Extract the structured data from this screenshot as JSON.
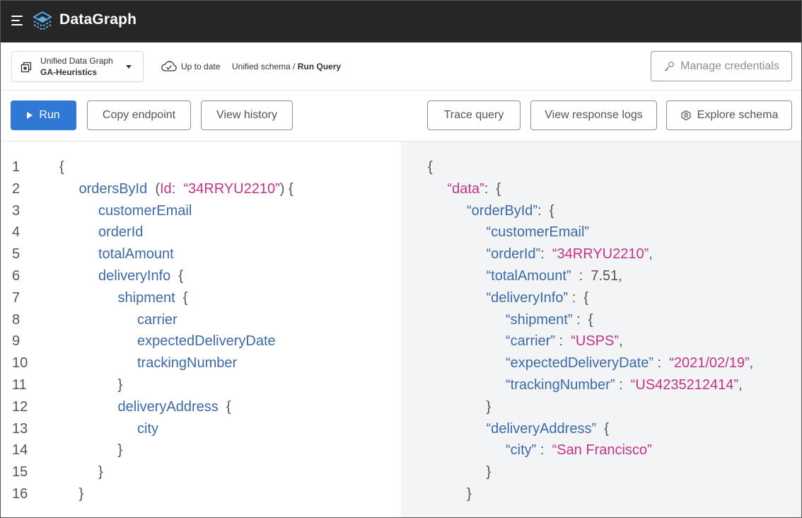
{
  "app": {
    "brand": "DataGraph",
    "colors": {
      "appbar": "#262626",
      "primary": "#2f78d4",
      "field": "#3c6aa8",
      "string": "#c2338a"
    },
    "icons": {
      "menu": "hamburger-menu-icon",
      "logo": "datagraph-logo-icon"
    }
  },
  "subheader": {
    "graph_name": "Unified Data Graph",
    "graph_variant": "GA-Heuristics",
    "status": "Up to date",
    "breadcrumb": {
      "parent": "Unified schema",
      "separator": " / ",
      "current": "Run Query"
    },
    "manage_credentials": "Manage credentials"
  },
  "toolbar": {
    "run": "Run",
    "copy_endpoint": "Copy endpoint",
    "view_history": "View history",
    "trace_query": "Trace query",
    "view_response_logs": "View response logs",
    "explore_schema": "Explore schema"
  },
  "query": {
    "line_numbers": [
      "1",
      "2",
      "3",
      "4",
      "5",
      "6",
      "7",
      "8",
      "9",
      "10",
      "11",
      "12",
      "13",
      "14",
      "15",
      "16"
    ],
    "lines": [
      {
        "indent": 0,
        "parts": [
          {
            "t": "{",
            "c": "p"
          }
        ]
      },
      {
        "indent": 1,
        "parts": [
          {
            "t": "ordersById",
            "c": "k"
          },
          {
            "t": "  (",
            "c": "p"
          },
          {
            "t": "Id",
            "c": "s"
          },
          {
            "t": ":  ",
            "c": "p"
          },
          {
            "t": "“34RRYU2210”",
            "c": "s"
          },
          {
            "t": ") {",
            "c": "p"
          }
        ]
      },
      {
        "indent": 2,
        "parts": [
          {
            "t": "customerEmail",
            "c": "k"
          }
        ]
      },
      {
        "indent": 2,
        "parts": [
          {
            "t": "orderId",
            "c": "k"
          }
        ]
      },
      {
        "indent": 2,
        "parts": [
          {
            "t": "totalAmount",
            "c": "k"
          }
        ]
      },
      {
        "indent": 2,
        "parts": [
          {
            "t": "deliveryInfo",
            "c": "k"
          },
          {
            "t": "  {",
            "c": "p"
          }
        ]
      },
      {
        "indent": 3,
        "parts": [
          {
            "t": "shipment",
            "c": "k"
          },
          {
            "t": "  {",
            "c": "p"
          }
        ]
      },
      {
        "indent": 4,
        "parts": [
          {
            "t": "carrier",
            "c": "k"
          }
        ]
      },
      {
        "indent": 4,
        "parts": [
          {
            "t": "expectedDeliveryDate",
            "c": "k"
          }
        ]
      },
      {
        "indent": 4,
        "parts": [
          {
            "t": "trackingNumber",
            "c": "k"
          }
        ]
      },
      {
        "indent": 3,
        "parts": [
          {
            "t": "}",
            "c": "p"
          }
        ]
      },
      {
        "indent": 3,
        "parts": [
          {
            "t": "deliveryAddress",
            "c": "k"
          },
          {
            "t": "  {",
            "c": "p"
          }
        ]
      },
      {
        "indent": 4,
        "parts": [
          {
            "t": "city",
            "c": "k"
          }
        ]
      },
      {
        "indent": 3,
        "parts": [
          {
            "t": "}",
            "c": "p"
          }
        ]
      },
      {
        "indent": 2,
        "parts": [
          {
            "t": "}",
            "c": "p"
          }
        ]
      },
      {
        "indent": 1,
        "parts": [
          {
            "t": "}",
            "c": "p"
          }
        ]
      }
    ]
  },
  "result": {
    "lines": [
      {
        "indent": 0,
        "parts": [
          {
            "t": "{",
            "c": "p"
          }
        ]
      },
      {
        "indent": 1,
        "parts": [
          {
            "t": "“data”",
            "c": "s"
          },
          {
            "t": ":  {",
            "c": "p"
          }
        ]
      },
      {
        "indent": 2,
        "parts": [
          {
            "t": "“orderById”",
            "c": "k"
          },
          {
            "t": ":  {",
            "c": "p"
          }
        ]
      },
      {
        "indent": 3,
        "parts": [
          {
            "t": "“customerEmail”",
            "c": "k"
          }
        ]
      },
      {
        "indent": 3,
        "parts": [
          {
            "t": "“orderId”",
            "c": "k"
          },
          {
            "t": ":  ",
            "c": "p"
          },
          {
            "t": "“34RRYU2210”",
            "c": "s"
          },
          {
            "t": ",",
            "c": "p"
          }
        ]
      },
      {
        "indent": 3,
        "parts": [
          {
            "t": "“totalAmount”",
            "c": "k"
          },
          {
            "t": "  :  7.51,",
            "c": "p"
          }
        ]
      },
      {
        "indent": 3,
        "parts": [
          {
            "t": "“deliveryInfo”",
            "c": "k"
          },
          {
            "t": " :  {",
            "c": "p"
          }
        ]
      },
      {
        "indent": 4,
        "parts": [
          {
            "t": "“shipment”",
            "c": "k"
          },
          {
            "t": " :  {",
            "c": "p"
          }
        ]
      },
      {
        "indent": 4,
        "parts": [
          {
            "t": "“carrier”",
            "c": "k"
          },
          {
            "t": " :  ",
            "c": "p"
          },
          {
            "t": "“USPS”",
            "c": "s"
          },
          {
            "t": ",",
            "c": "p"
          }
        ]
      },
      {
        "indent": 4,
        "parts": [
          {
            "t": "“expectedDeliveryDate”",
            "c": "k"
          },
          {
            "t": " :  ",
            "c": "p"
          },
          {
            "t": "“2021/02/19”",
            "c": "s"
          },
          {
            "t": ",",
            "c": "p"
          }
        ]
      },
      {
        "indent": 4,
        "parts": [
          {
            "t": "“trackingNumber”",
            "c": "k"
          },
          {
            "t": " :  ",
            "c": "p"
          },
          {
            "t": "“US4235212414”",
            "c": "s"
          },
          {
            "t": ",",
            "c": "p"
          }
        ]
      },
      {
        "indent": 3,
        "parts": [
          {
            "t": "}",
            "c": "p"
          }
        ]
      },
      {
        "indent": 3,
        "parts": [
          {
            "t": "“deliveryAddress”",
            "c": "k"
          },
          {
            "t": "  {",
            "c": "p"
          }
        ]
      },
      {
        "indent": 4,
        "parts": [
          {
            "t": "“city”",
            "c": "k"
          },
          {
            "t": " :  ",
            "c": "p"
          },
          {
            "t": "“San Francisco”",
            "c": "s"
          }
        ]
      },
      {
        "indent": 3,
        "parts": [
          {
            "t": "}",
            "c": "p"
          }
        ]
      },
      {
        "indent": 2,
        "parts": [
          {
            "t": "}",
            "c": "p"
          }
        ]
      }
    ]
  }
}
